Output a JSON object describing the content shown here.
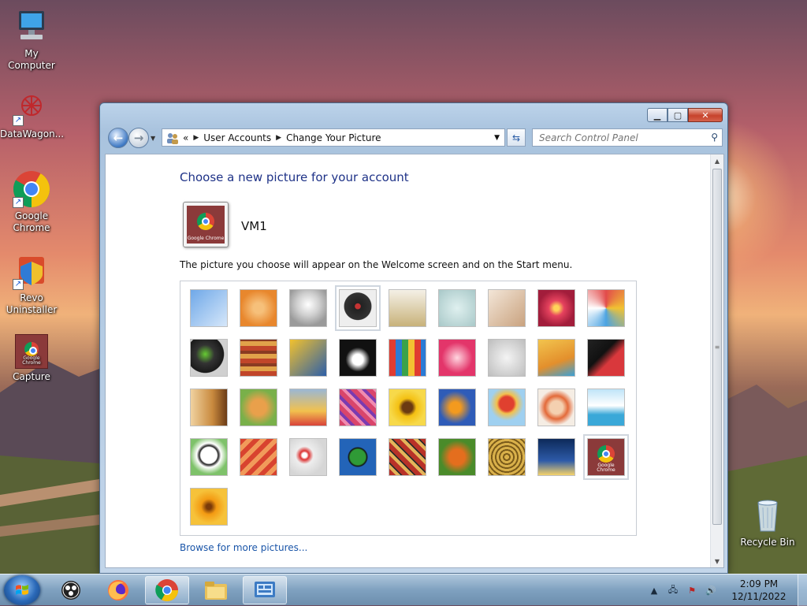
{
  "desktop": {
    "icons": [
      {
        "label": "My Computer"
      },
      {
        "label": "DataWagon..."
      },
      {
        "label": "Google Chrome"
      },
      {
        "label": "Revo Uninstaller"
      },
      {
        "label": "Capture"
      },
      {
        "label": "Recycle Bin"
      }
    ],
    "capture_tile_text": "Google Chrome"
  },
  "window": {
    "address": {
      "overflow": "«",
      "crumbs": [
        "User Accounts",
        "Change Your Picture"
      ]
    },
    "search": {
      "placeholder": "Search Control Panel"
    },
    "heading": "Choose a new picture for your account",
    "user": {
      "name": "VM1",
      "picture_label": "Google Chrome"
    },
    "description": "The picture you choose will appear on the Welcome screen and on the Start menu.",
    "browse_link": "Browse for more pictures...",
    "pictures": [
      "ferris-wheel",
      "starfish",
      "robot-figurine",
      "vinyl-record",
      "lucky-cat",
      "gyroscope",
      "kitten",
      "flower-pink",
      "pinwheel",
      "ball",
      "fabric-stripes",
      "leaf",
      "dog-border-collie",
      "crayons",
      "paper-star",
      "jacks",
      "stairs",
      "origami-crane",
      "guitar",
      "pomeranian",
      "toy-robot",
      "yarn",
      "sunflower",
      "fish",
      "hot-air-balloon",
      "daruma",
      "sailboat",
      "soccer-ball",
      "fabric-red",
      "marbles",
      "window-green",
      "rug",
      "butterfly",
      "spiral-sculpture",
      "lighthouse",
      "chrome-selected",
      "gerbera-orange"
    ],
    "selected_picture": "Google Chrome"
  },
  "taskbar": {
    "items": [
      "Obs",
      "Firefox",
      "Chrome",
      "Explorer",
      "Control Panel"
    ],
    "clock": {
      "time": "2:09 PM",
      "date": "12/11/2022"
    }
  }
}
